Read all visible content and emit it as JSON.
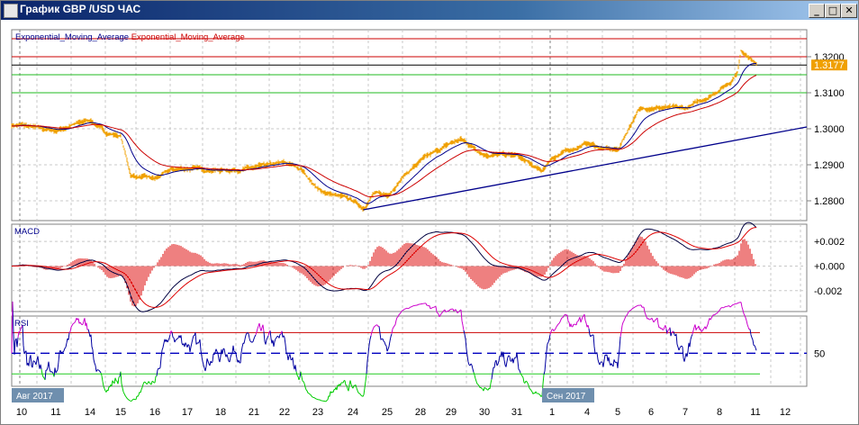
{
  "window": {
    "title": "График GBP /USD  ЧАС",
    "minimize": "_",
    "maximize": "□",
    "close": "✕"
  },
  "legend": {
    "ema1": "Exponential_Moving_Average",
    "ema2": "Exponential_Moving_Average"
  },
  "colors": {
    "price": "#f0a000",
    "ema_fast": "#00008b",
    "ema_slow": "#cc0000",
    "trend": "#00008b",
    "macd_hist": "#dd0000",
    "rsi": "#0000a0",
    "rsi_over": "#cc00cc",
    "rsi_under": "#00cc00"
  },
  "chart_data": {
    "type": "line",
    "symbol": "GBP/USD",
    "timeframe": "H1",
    "price_ticks": [
      "1.3200",
      "1.3100",
      "1.3000",
      "1.2900",
      "1.2800"
    ],
    "price_tick_values": [
      1.32,
      1.31,
      1.3,
      1.29,
      1.28
    ],
    "current_price": "1.3177",
    "current_price_value": 1.3177,
    "levels": {
      "red": [
        1.325,
        1.32
      ],
      "black": [
        1.3177
      ],
      "green": [
        1.315,
        1.31
      ]
    },
    "ylim": [
      1.2745,
      1.3275
    ],
    "x_labels": [
      "10",
      "11",
      "14",
      "15",
      "16",
      "17",
      "18",
      "21",
      "22",
      "23",
      "24",
      "25",
      "28",
      "29",
      "30",
      "31",
      "1",
      "4",
      "5",
      "6",
      "7",
      "8",
      "11",
      "12"
    ],
    "month_labels": [
      {
        "label": "Авг 2017",
        "at": 0
      },
      {
        "label": "Сен 2017",
        "at": 16
      }
    ],
    "close_keypoints": [
      [
        0,
        1.301
      ],
      [
        0.5,
        1.3
      ],
      [
        1,
        1.2995
      ],
      [
        2,
        1.3025
      ],
      [
        2.5,
        1.299
      ],
      [
        3,
        1.298
      ],
      [
        3.3,
        1.287
      ],
      [
        4,
        1.286
      ],
      [
        4.5,
        1.2885
      ],
      [
        5,
        1.289
      ],
      [
        6,
        1.2885
      ],
      [
        7,
        1.289
      ],
      [
        8,
        1.2905
      ],
      [
        8.5,
        1.289
      ],
      [
        9,
        1.283
      ],
      [
        10,
        1.28
      ],
      [
        10.3,
        1.278
      ],
      [
        10.6,
        1.282
      ],
      [
        11,
        1.2815
      ],
      [
        11.5,
        1.287
      ],
      [
        12,
        1.291
      ],
      [
        13,
        1.296
      ],
      [
        13.3,
        1.297
      ],
      [
        14,
        1.293
      ],
      [
        15,
        1.2925
      ],
      [
        15.7,
        1.288
      ],
      [
        16,
        1.292
      ],
      [
        17,
        1.296
      ],
      [
        17.5,
        1.2945
      ],
      [
        18,
        1.294
      ],
      [
        18.6,
        1.305
      ],
      [
        19,
        1.306
      ],
      [
        20,
        1.3055
      ],
      [
        20.7,
        1.309
      ],
      [
        21,
        1.311
      ],
      [
        21.3,
        1.313
      ],
      [
        21.5,
        1.316
      ],
      [
        21.6,
        1.3215
      ],
      [
        21.8,
        1.3205
      ],
      [
        22.05,
        1.3177
      ]
    ],
    "trendline": [
      [
        10.3,
        1.2775
      ],
      [
        24.6,
        1.3005
      ]
    ],
    "macd": {
      "title": "MACD",
      "ticks": [
        "+0.002",
        "+0.000",
        "-0.002"
      ],
      "tick_values": [
        0.002,
        0,
        -0.002
      ],
      "ylim": [
        -0.0037,
        0.0034
      ]
    },
    "rsi": {
      "title": "RSI",
      "ticks": [
        "50"
      ],
      "tick_values": [
        50
      ],
      "levels": [
        70,
        50,
        30
      ],
      "ylim": [
        18,
        86
      ]
    }
  }
}
